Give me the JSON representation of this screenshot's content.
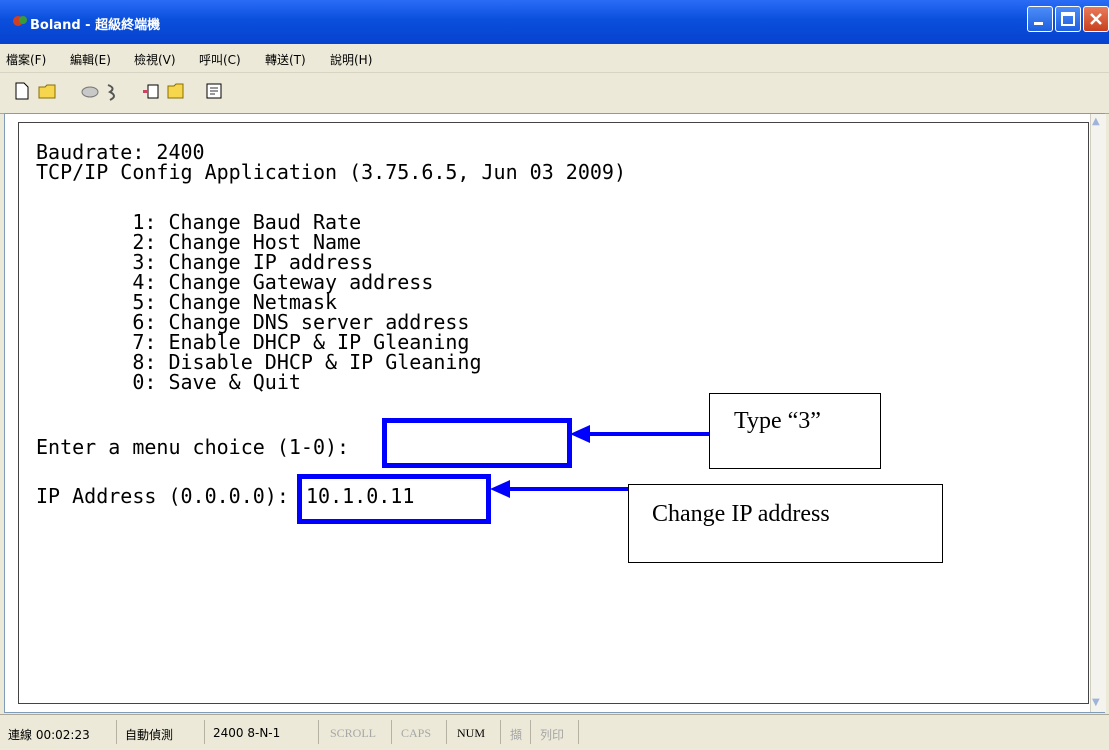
{
  "window": {
    "title": "Boland - 超級終端機"
  },
  "menu": {
    "items": [
      "檔案(F)",
      "編輯(E)",
      "檢視(V)",
      "呼叫(C)",
      "轉送(T)",
      "說明(H)"
    ]
  },
  "toolbar": {
    "icons": [
      "new-file-icon",
      "open-folder-icon",
      "phone-icon",
      "disconnect-icon",
      "send-icon",
      "receive-icon",
      "properties-icon"
    ]
  },
  "terminal": {
    "lines": [
      "Baudrate: 2400",
      "TCP/IP Config Application (3.75.6.5, Jun 03 2009)",
      "        1: Change Baud Rate",
      "        2: Change Host Name",
      "        3: Change IP address",
      "        4: Change Gateway address",
      "        5: Change Netmask",
      "        6: Change DNS server address",
      "        7: Enable DHCP & IP Gleaning",
      "        8: Disable DHCP & IP Gleaning",
      "        0: Save & Quit"
    ],
    "prompt": "Enter a menu choice (1-0):",
    "ip_label": "IP Address (0.0.0.0):",
    "ip_value": "10.1.0.11"
  },
  "annotations": {
    "callout1": "Type “3”",
    "callout2": "Change IP address",
    "color": "#0000ff"
  },
  "status": {
    "connected": "連線 00:02:23",
    "detect": "自動偵測",
    "params": "2400 8-N-1",
    "scroll": "SCROLL",
    "caps": "CAPS",
    "num": "NUM",
    "capture": "擷",
    "print": "列印"
  }
}
